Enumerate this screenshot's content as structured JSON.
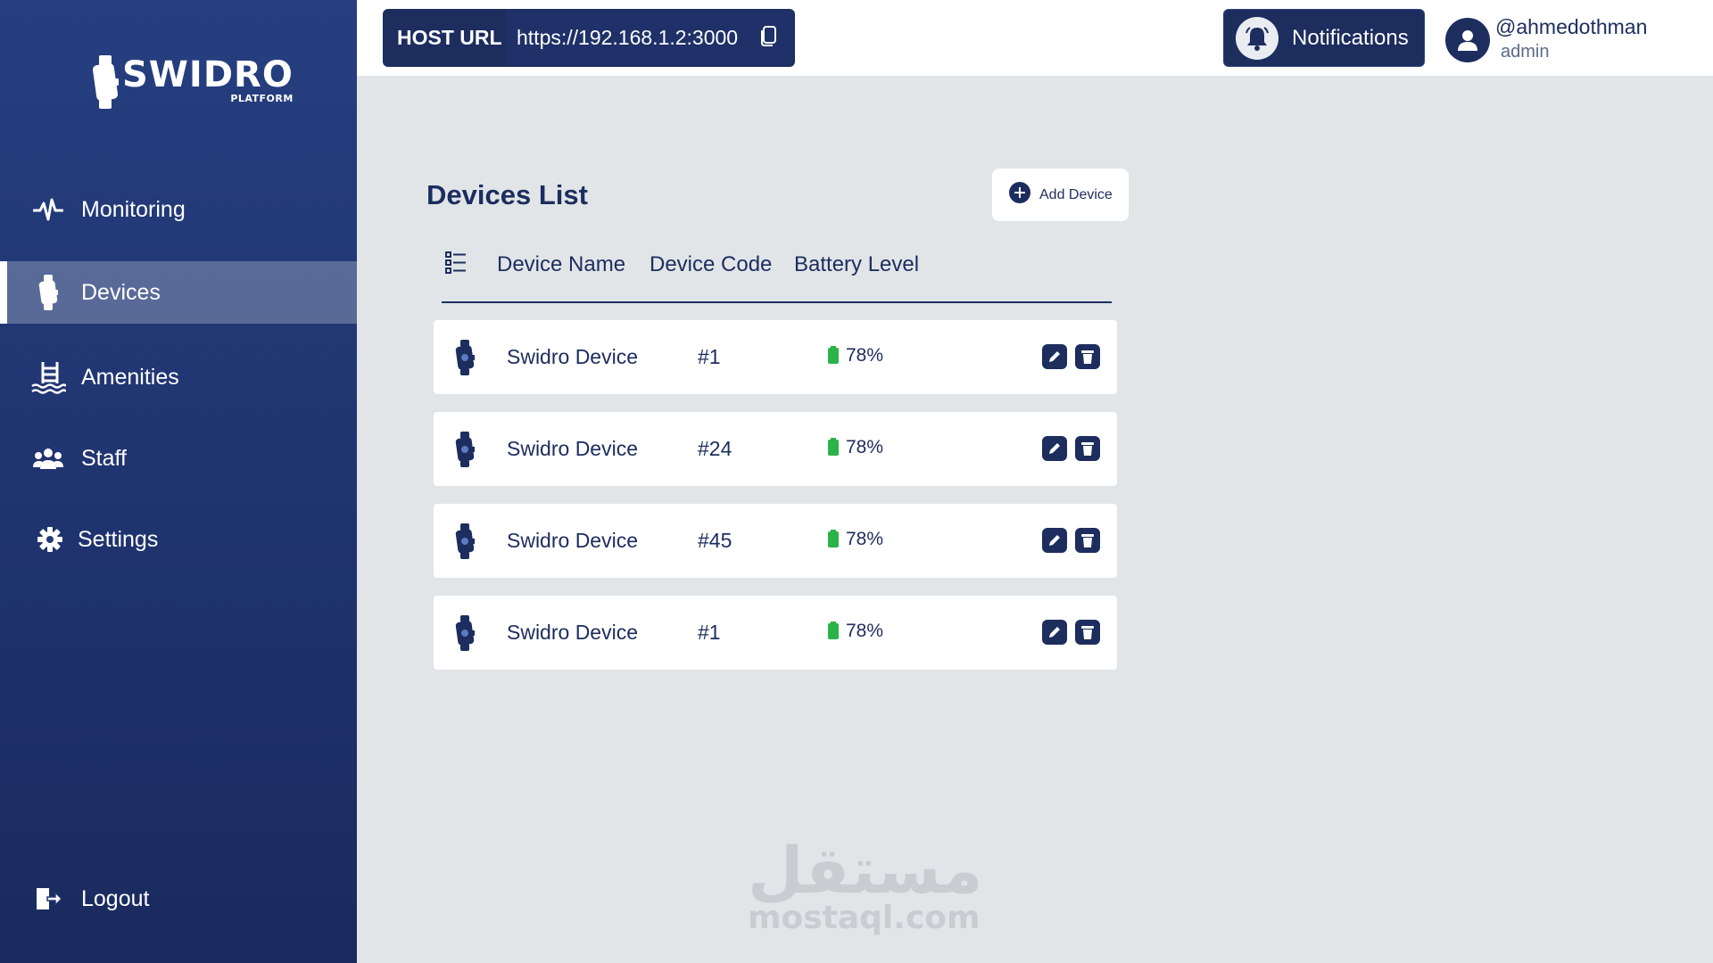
{
  "brand": {
    "name": "SWIDRO",
    "sub": "PLATFORM"
  },
  "sidebar": {
    "items": [
      {
        "label": "Monitoring",
        "icon": "pulse-icon",
        "active": false
      },
      {
        "label": "Devices",
        "icon": "device-icon",
        "active": true
      },
      {
        "label": "Amenities",
        "icon": "pool-icon",
        "active": false
      },
      {
        "label": "Staff",
        "icon": "users-icon",
        "active": false
      },
      {
        "label": "Settings",
        "icon": "gear-icon",
        "active": false
      }
    ],
    "logout": "Logout"
  },
  "topbar": {
    "host_label": "HOST URL",
    "host_url": "https://192.168.1.2:3000",
    "notifications_label": "Notifications",
    "username": "@ahmedothman",
    "role": "admin"
  },
  "main": {
    "title": "Devices List",
    "add_label": "Add Device",
    "columns": [
      "Device Name",
      "Device Code",
      "Battery Level"
    ],
    "rows": [
      {
        "name": "Swidro Device",
        "code": "#1",
        "battery": "78%"
      },
      {
        "name": "Swidro Device",
        "code": "#24",
        "battery": "78%"
      },
      {
        "name": "Swidro Device",
        "code": "#45",
        "battery": "78%"
      },
      {
        "name": "Swidro Device",
        "code": "#1",
        "battery": "78%"
      }
    ]
  },
  "watermark": {
    "arabic": "مستقل",
    "latin": "mostaql.com"
  },
  "colors": {
    "navy": "#1c2d5e",
    "sidebar": "#263f80",
    "battery": "#2bb34a",
    "background": "#e1e5e8"
  }
}
